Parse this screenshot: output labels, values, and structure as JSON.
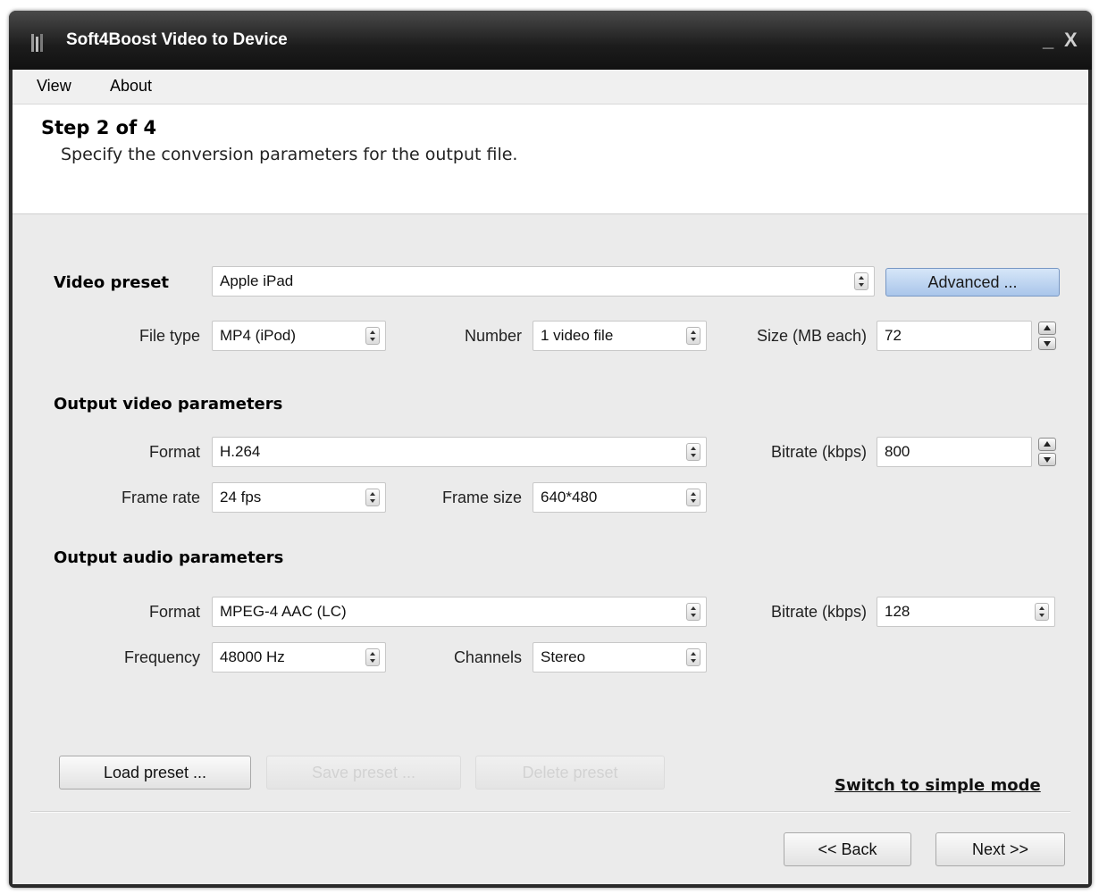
{
  "window": {
    "title": "Soft4Boost Video to Device",
    "minimize": "_",
    "close": "X"
  },
  "menu": {
    "view": "View",
    "about": "About"
  },
  "header": {
    "step": "Step 2 of 4",
    "description": "Specify the conversion parameters for the output file."
  },
  "preset": {
    "label": "Video preset",
    "value": "Apple iPad",
    "advanced_label": "Advanced ...",
    "file_type_label": "File type",
    "file_type_value": "MP4 (iPod)",
    "number_label": "Number",
    "number_value": "1 video file",
    "size_label": "Size (MB each)",
    "size_value": "72"
  },
  "video": {
    "section": "Output video parameters",
    "format_label": "Format",
    "format_value": "H.264",
    "bitrate_label": "Bitrate (kbps)",
    "bitrate_value": "800",
    "frame_rate_label": "Frame rate",
    "frame_rate_value": "24 fps",
    "frame_size_label": "Frame size",
    "frame_size_value": "640*480"
  },
  "audio": {
    "section": "Output audio parameters",
    "format_label": "Format",
    "format_value": "MPEG-4 AAC (LC)",
    "bitrate_label": "Bitrate (kbps)",
    "bitrate_value": "128",
    "frequency_label": "Frequency",
    "frequency_value": "48000 Hz",
    "channels_label": "Channels",
    "channels_value": "Stereo"
  },
  "footer": {
    "load_preset": "Load preset ...",
    "save_preset": "Save preset ...",
    "delete_preset": "Delete preset",
    "switch_mode": "Switch to simple mode",
    "back": "<< Back",
    "next": "Next >>"
  },
  "colors": {
    "titlebar": "#1c1c1c",
    "client_bg": "#ebebeb",
    "advanced_button": "#a9c5ea"
  }
}
